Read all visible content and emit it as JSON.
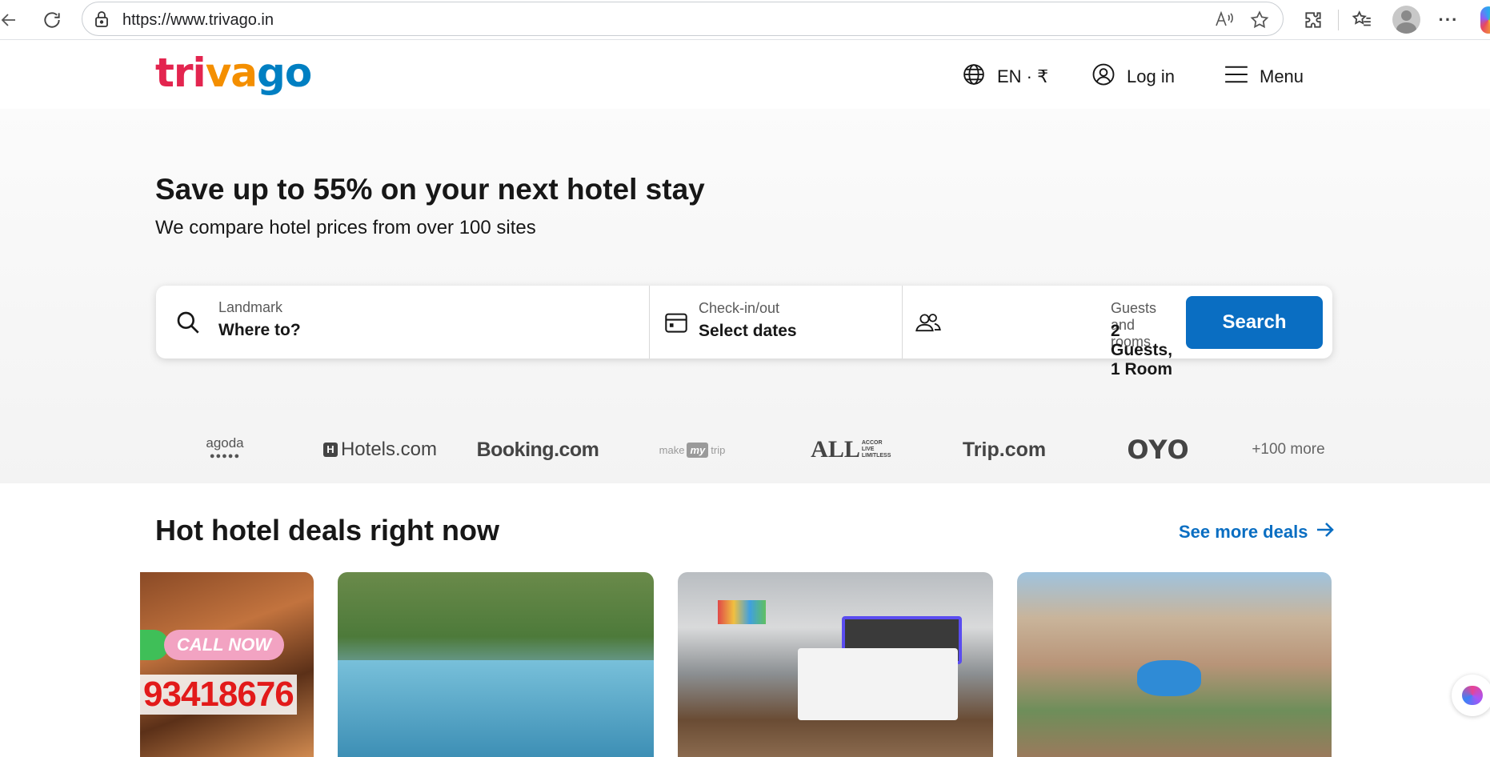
{
  "browser": {
    "url": "https://www.trivago.in"
  },
  "header": {
    "logo": {
      "part1": "tri",
      "part2": "va",
      "part3": "go"
    },
    "language_currency": "EN · ₹",
    "login": "Log in",
    "menu": "Menu"
  },
  "hero": {
    "title": "Save up to 55% on your next hotel stay",
    "subtitle": "We compare hotel prices from over 100 sites"
  },
  "search": {
    "destination": {
      "label": "Landmark",
      "value": "Where to?"
    },
    "dates": {
      "label": "Check-in/out",
      "value": "Select dates"
    },
    "guests": {
      "label": "Guests and rooms",
      "value": "2 Guests, 1 Room"
    },
    "button": "Search"
  },
  "partners": {
    "items": [
      "agoda",
      "Hotels.com",
      "Booking.com",
      "make my trip",
      "ALL",
      "Trip.com",
      "OYO"
    ],
    "agoda_dots": "●●●●●",
    "all_small": "ACCOR LIVE LIMITLESS",
    "mmt": {
      "make": "make",
      "my": "my",
      "trip": "trip"
    },
    "more": "+100 more"
  },
  "deals": {
    "title": "Hot hotel deals right now",
    "see_more": "See more deals",
    "card1": {
      "call_now": "CALL NOW",
      "phone": "93418676"
    }
  },
  "colors": {
    "brand_red": "#e3254f",
    "brand_orange": "#f48f00",
    "brand_blue": "#007fc2",
    "button_blue": "#0a6ec2"
  }
}
